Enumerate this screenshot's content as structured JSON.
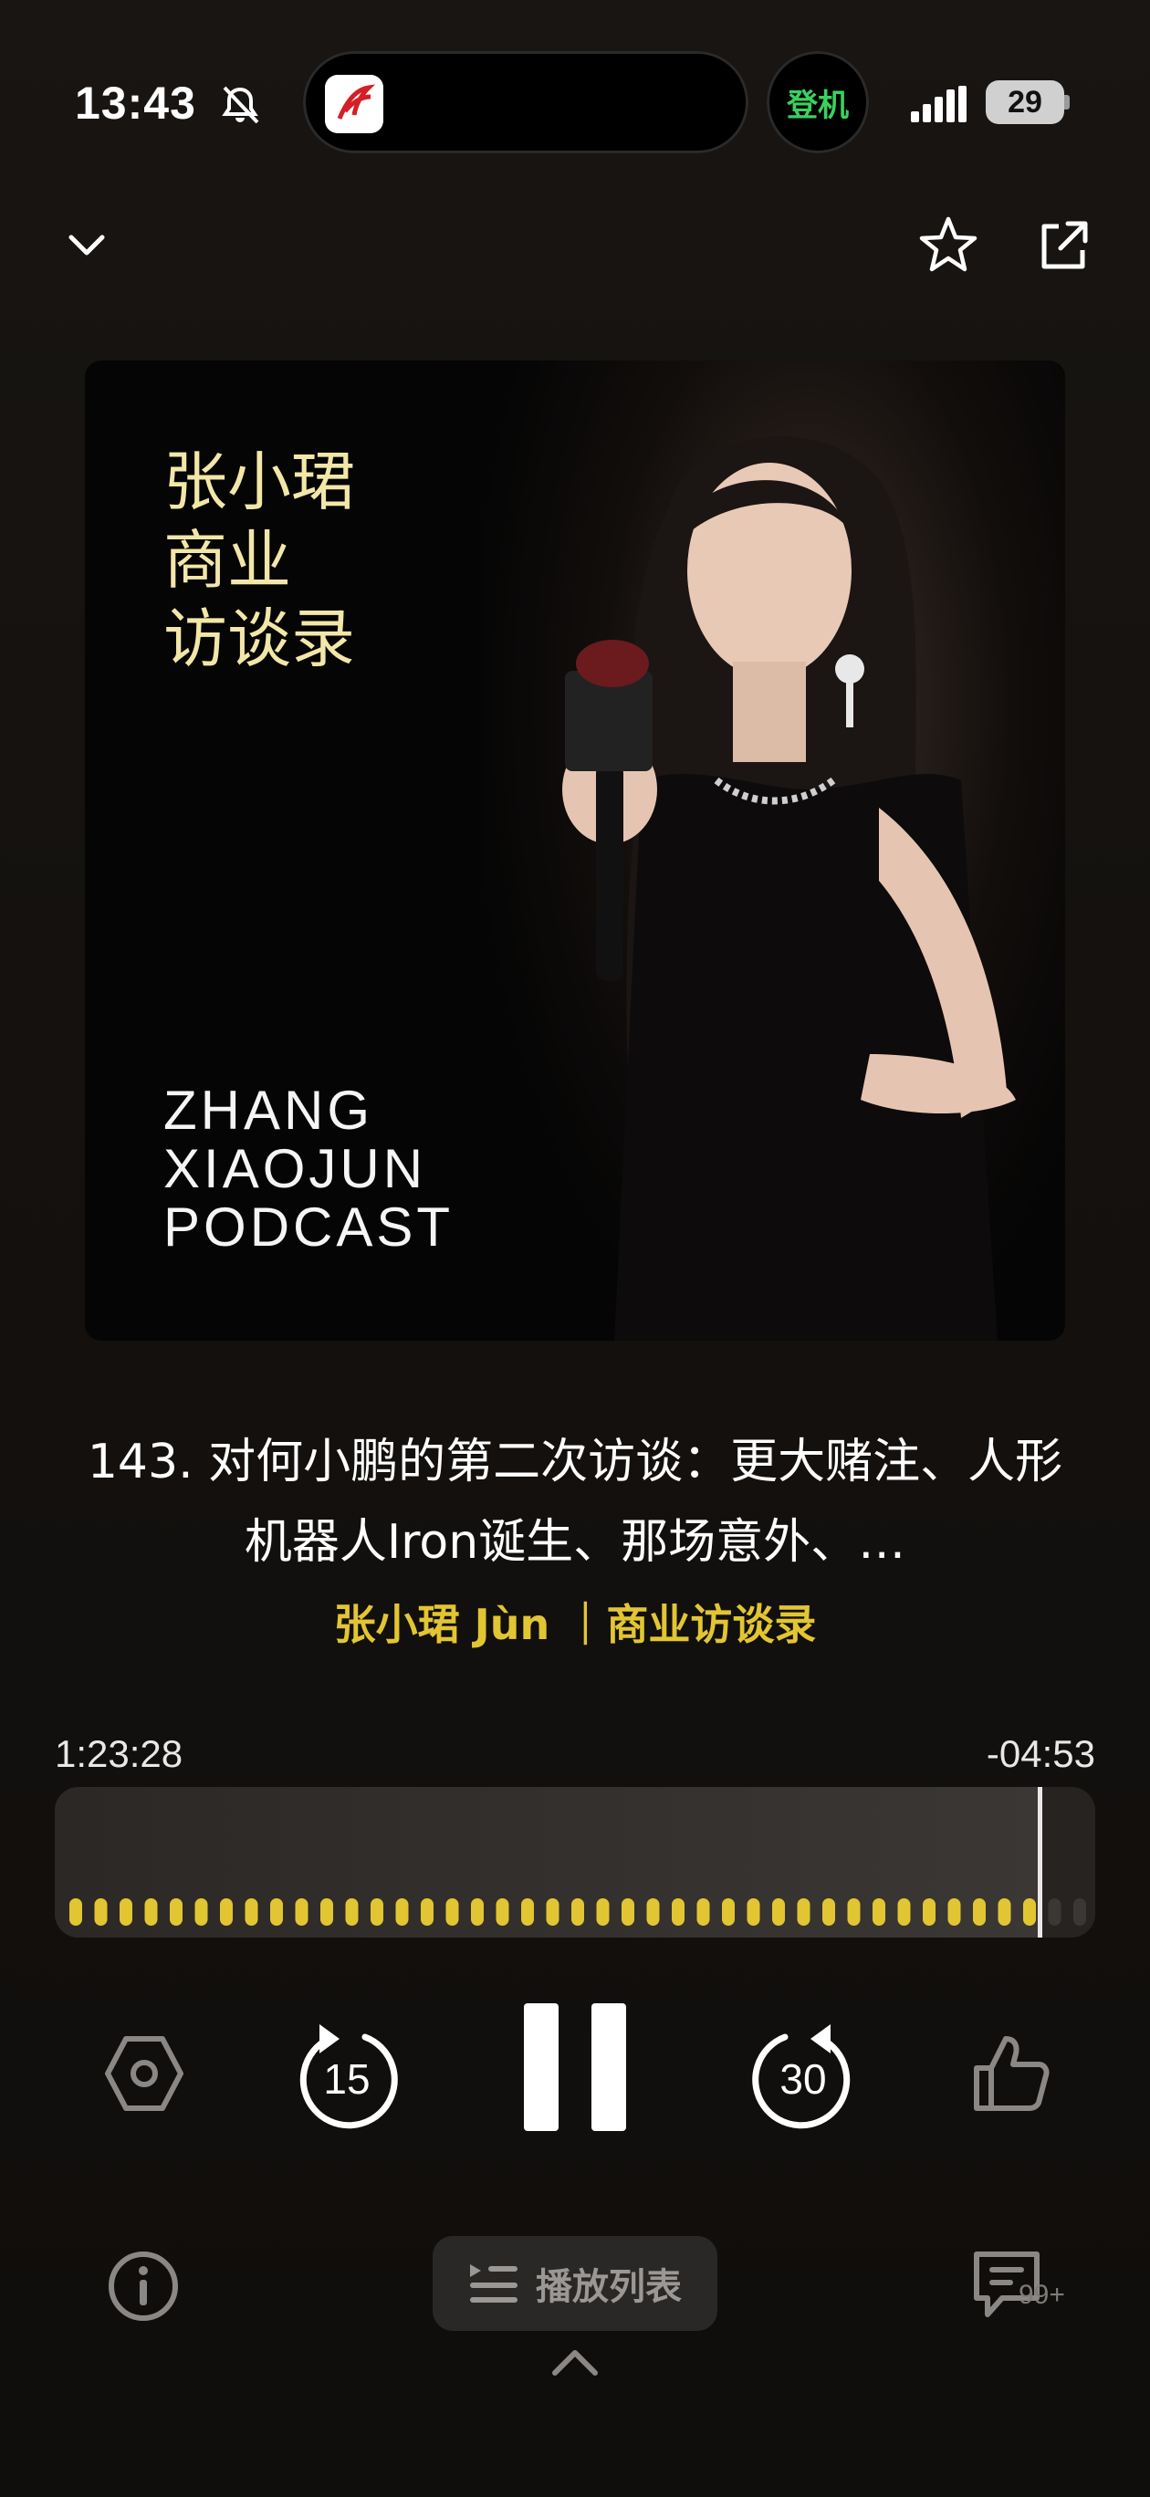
{
  "status_bar": {
    "time": "13:43",
    "checkin_label": "登机",
    "battery": "29"
  },
  "cover": {
    "title_cn_lines": [
      "张小珺",
      "商业",
      "访谈录"
    ],
    "title_en_lines": [
      "ZHANG",
      "XIAOJUN",
      "PODCAST"
    ]
  },
  "episode": {
    "title": "143. 对何小鹏的第二次访谈：更大赌注、人形机器人Iron诞生、那场意外、…",
    "author": "张小珺 Jùn ｜商业访谈录"
  },
  "player": {
    "elapsed": "1:23:28",
    "remaining": "-04:53",
    "progress": 0.945
  },
  "bottom_bar": {
    "playlist_label": "播放列表",
    "comment_count": "99+"
  },
  "icons": {
    "collapse": "chevron-down-icon",
    "favorite": "star-icon",
    "share": "share-icon",
    "speed": "speed-hexagon-icon",
    "rewind": "rewind-15-icon",
    "pause": "pause-icon",
    "forward": "forward-30-icon",
    "like": "thumbs-up-icon",
    "info": "info-icon",
    "playlist": "playlist-icon",
    "comments": "comment-icon",
    "expand": "chevron-up-icon"
  },
  "colors": {
    "accent": "#e2c532",
    "cover_title": "#f3e7a8",
    "checkin": "#3bd15e"
  }
}
